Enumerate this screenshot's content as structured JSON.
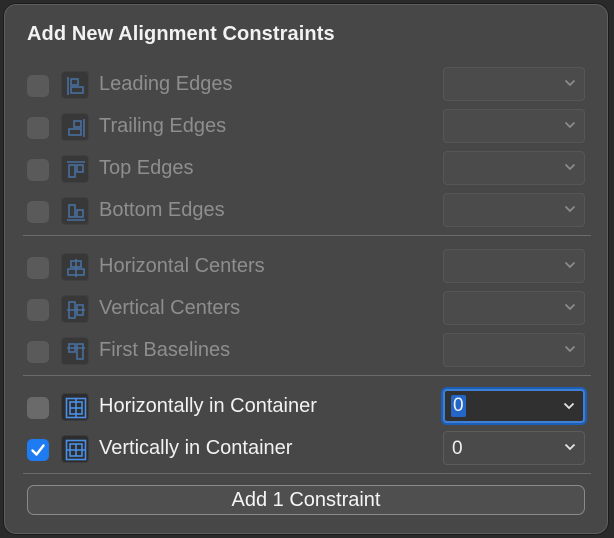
{
  "title": "Add New Alignment Constraints",
  "colors": {
    "accent": "#1f7bf2",
    "icon_blue": "#4a90e8"
  },
  "constraints": [
    {
      "label": "Leading Edges",
      "icon": "leading-edges-icon",
      "checked": false,
      "enabled": false,
      "value": ""
    },
    {
      "label": "Trailing Edges",
      "icon": "trailing-edges-icon",
      "checked": false,
      "enabled": false,
      "value": ""
    },
    {
      "label": "Top Edges",
      "icon": "top-edges-icon",
      "checked": false,
      "enabled": false,
      "value": ""
    },
    {
      "label": "Bottom Edges",
      "icon": "bottom-edges-icon",
      "checked": false,
      "enabled": false,
      "value": ""
    },
    {
      "label": "Horizontal Centers",
      "icon": "horizontal-centers-icon",
      "checked": false,
      "enabled": false,
      "value": ""
    },
    {
      "label": "Vertical Centers",
      "icon": "vertical-centers-icon",
      "checked": false,
      "enabled": false,
      "value": ""
    },
    {
      "label": "First Baselines",
      "icon": "first-baselines-icon",
      "checked": false,
      "enabled": false,
      "value": ""
    },
    {
      "label": "Horizontally in Container",
      "icon": "horizontally-in-container-icon",
      "checked": false,
      "enabled": true,
      "value": "0"
    },
    {
      "label": "Vertically in Container",
      "icon": "vertically-in-container-icon",
      "checked": true,
      "enabled": true,
      "value": "0"
    }
  ],
  "add_button_label": "Add 1 Constraint"
}
